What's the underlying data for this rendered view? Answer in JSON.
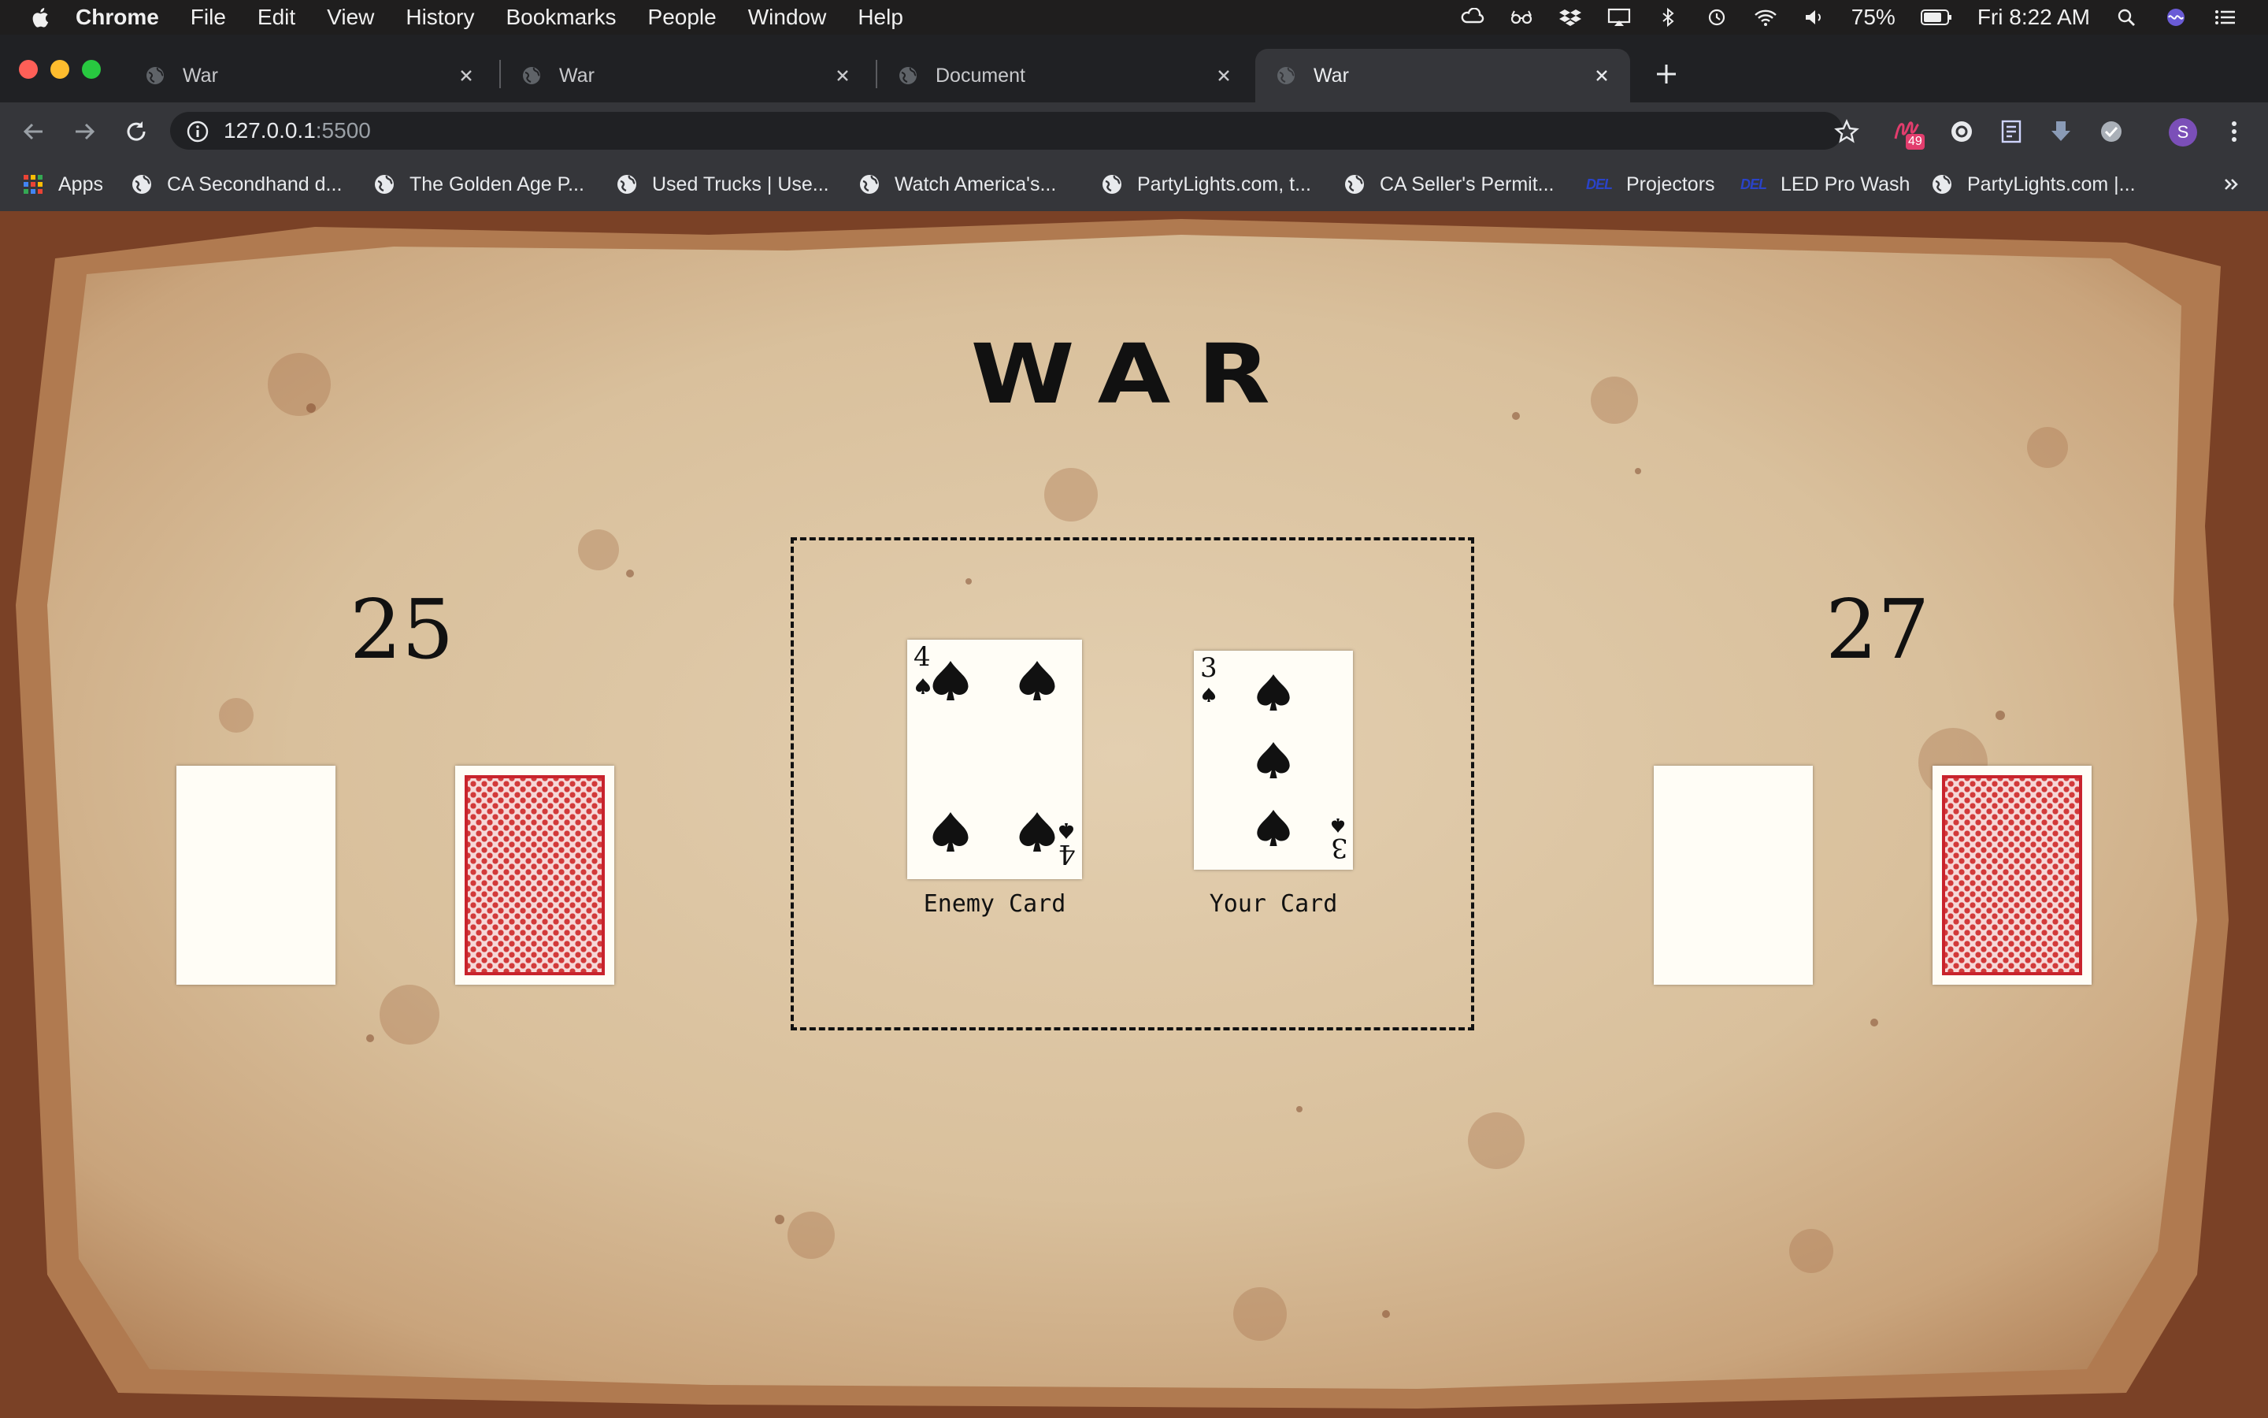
{
  "menubar": {
    "app_name": "Chrome",
    "items": [
      "File",
      "Edit",
      "View",
      "History",
      "Bookmarks",
      "People",
      "Window",
      "Help"
    ],
    "battery": "75%",
    "clock": "Fri 8:22 AM"
  },
  "tabs": [
    {
      "title": "War",
      "active": false
    },
    {
      "title": "War",
      "active": false
    },
    {
      "title": "Document",
      "active": false
    },
    {
      "title": "War",
      "active": true
    }
  ],
  "address_bar": {
    "host": "127.0.0.1",
    "port": ":5500"
  },
  "extensions": {
    "badge": "49",
    "profile_initial": "S"
  },
  "bookmarks": [
    {
      "label": "Apps",
      "icon": "apps-grid-icon"
    },
    {
      "label": "CA Secondhand d...",
      "icon": "globe-icon"
    },
    {
      "label": "The Golden Age P...",
      "icon": "globe-icon"
    },
    {
      "label": "Used Trucks | Use...",
      "icon": "globe-icon"
    },
    {
      "label": "Watch America's...",
      "icon": "globe-icon"
    },
    {
      "label": "PartyLights.com, t...",
      "icon": "globe-icon"
    },
    {
      "label": "CA Seller's Permit...",
      "icon": "globe-icon"
    },
    {
      "label": "Projectors",
      "icon": "del-icon",
      "badge_text": "DEL"
    },
    {
      "label": "LED Pro Wash",
      "icon": "del-icon",
      "badge_text": "DEL"
    },
    {
      "label": "PartyLights.com |...",
      "icon": "globe-icon"
    }
  ],
  "game": {
    "title": "WAR",
    "enemy_score": "25",
    "player_score": "27",
    "enemy_card": {
      "rank": "4",
      "suit": "spades",
      "label": "Enemy Card"
    },
    "player_card": {
      "rank": "3",
      "suit": "spades",
      "label": "Your Card"
    }
  },
  "colors": {
    "parchment": "#dcc6a6",
    "burnt_edge": "#7a4126",
    "card_back_red": "#c8232c",
    "chrome_dark": "#202124",
    "chrome_toolbar": "#35363a"
  }
}
